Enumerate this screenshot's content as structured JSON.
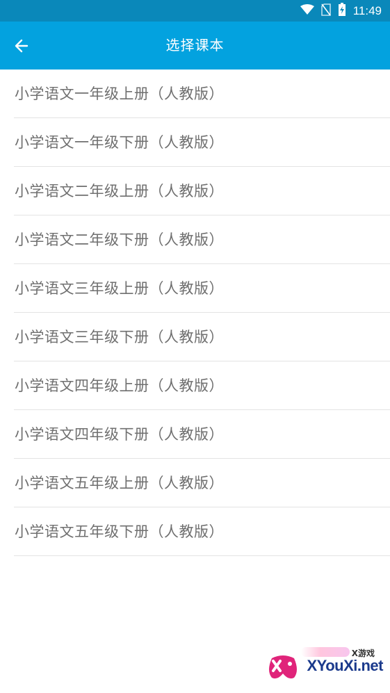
{
  "status_bar": {
    "time": "11:49",
    "icons": [
      "wifi-icon",
      "no-sim-icon",
      "battery-charging-icon"
    ]
  },
  "app_bar": {
    "back_icon": "arrow-left-icon",
    "title": "选择课本"
  },
  "textbooks": [
    {
      "label": "小学语文一年级上册（人教版）"
    },
    {
      "label": "小学语文一年级下册（人教版）"
    },
    {
      "label": "小学语文二年级上册（人教版）"
    },
    {
      "label": "小学语文二年级下册（人教版）"
    },
    {
      "label": "小学语文三年级上册（人教版）"
    },
    {
      "label": "小学语文三年级下册（人教版）"
    },
    {
      "label": "小学语文四年级上册（人教版）"
    },
    {
      "label": "小学语文四年级下册（人教版）"
    },
    {
      "label": "小学语文五年级上册（人教版）"
    },
    {
      "label": "小学语文五年级下册（人教版）"
    }
  ],
  "watermark": {
    "top_text": "X游戏",
    "brand_text": "XYouXi.net"
  },
  "colors": {
    "status_bar": "#0a88ba",
    "app_bar": "#03a2df",
    "text": "#6f6f6f",
    "divider": "#e3e3e3"
  }
}
